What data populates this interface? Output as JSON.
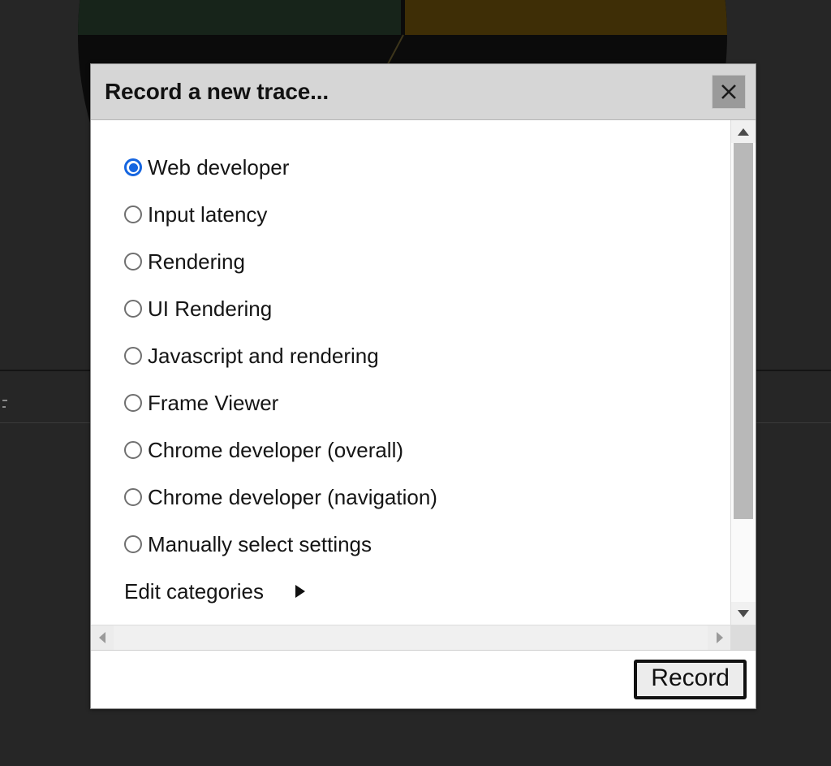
{
  "background": {
    "app_background_color": "#262626",
    "chart": {
      "left_quadrant_color": "#17241a",
      "right_quadrant_color": "#3e2e06",
      "ring_color": "#0b0b0b"
    }
  },
  "dialog": {
    "title": "Record a new trace...",
    "close_icon": "close-icon",
    "accent_color": "#1565e0",
    "options": [
      {
        "label": "Web developer",
        "checked": true
      },
      {
        "label": "Input latency",
        "checked": false
      },
      {
        "label": "Rendering",
        "checked": false
      },
      {
        "label": "UI Rendering",
        "checked": false
      },
      {
        "label": "Javascript and rendering",
        "checked": false
      },
      {
        "label": "Frame Viewer",
        "checked": false
      },
      {
        "label": "Chrome developer (overall)",
        "checked": false
      },
      {
        "label": "Chrome developer (navigation)",
        "checked": false
      },
      {
        "label": "Manually select settings",
        "checked": false
      }
    ],
    "edit_categories": {
      "label": "Edit categories",
      "expander_icon": "triangle-right-icon"
    },
    "scrollbars": {
      "vertical": {
        "up_icon": "triangle-up-icon",
        "down_icon": "triangle-down-icon"
      },
      "horizontal": {
        "left_icon": "triangle-left-icon",
        "right_icon": "triangle-right-icon"
      }
    },
    "footer": {
      "record_label": "Record"
    }
  }
}
